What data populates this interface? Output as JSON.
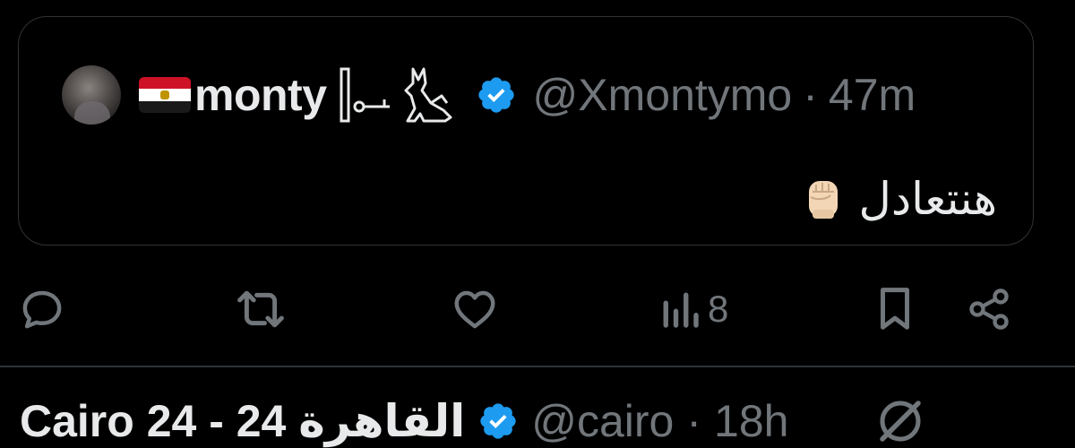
{
  "quote": {
    "author": {
      "flag_icon": "egypt-flag-icon",
      "name": "monty",
      "decoration_icon": "egyptian-hieroglyph-icons",
      "verified_icon": "verified-badge-icon",
      "handle": "@Xmontymo",
      "separator": "·",
      "time": "47m"
    },
    "text": "هنتعادل",
    "emoji_icon": "raised-fist-emoji-icon"
  },
  "actions": {
    "reply_icon": "reply-icon",
    "retweet_icon": "retweet-icon",
    "like_icon": "like-heart-icon",
    "views_icon": "views-chart-icon",
    "views_count": "8",
    "bookmark_icon": "bookmark-icon",
    "share_icon": "share-icon"
  },
  "next_tweet": {
    "name": "Cairo 24 - 24 القاهرة",
    "verified_icon": "verified-badge-icon",
    "handle": "@cairo",
    "separator": "·",
    "time": "18h"
  },
  "colors": {
    "background": "#000000",
    "text_primary": "#e7e9ea",
    "text_secondary": "#71767b",
    "border": "#2f3336",
    "verified_blue": "#1d9bf0"
  }
}
